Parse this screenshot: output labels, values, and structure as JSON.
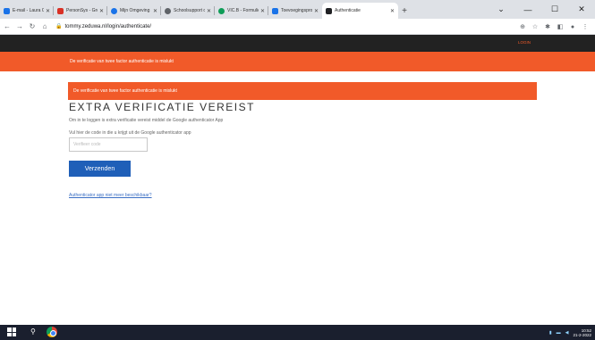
{
  "browser": {
    "tabs": [
      {
        "label": "E-mail - Laura Calleri",
        "favicon_color": "#1a73e8"
      },
      {
        "label": "PersonSys - Groep",
        "favicon_color": "#d93025"
      },
      {
        "label": "Mijn Omgeving Zedu",
        "favicon_color": "#1a73e8"
      },
      {
        "label": "Schoolsupport dashb",
        "favicon_color": "#5f6368"
      },
      {
        "label": "VIC.B - Formulieren T",
        "favicon_color": "#0f9d58"
      },
      {
        "label": "Toevoegingsprogramm",
        "favicon_color": "#1a73e8"
      },
      {
        "label": "Authenticatie",
        "favicon_color": "#202124",
        "active": true
      }
    ],
    "url": "tommy.zeduwa.nl/login/authenticate/"
  },
  "site": {
    "logout_label": "LOGIN",
    "banner_message": "De verificatie van twee factor authenticatie is mislukt",
    "alert_message": "De verificatie van twee factor authenticatie is mislukt",
    "title": "EXTRA VERIFICATIE VEREIST",
    "intro": "Om in te loggen is extra verificatie vereist middel de Google authenticator App",
    "code_label": "Vul hier de code in die u krijgt uit de Google authenticator app",
    "code_placeholder": "Verifieer code",
    "submit_label": "Verzenden",
    "help_link": "Authenticator app niet meer beschikbaar?"
  },
  "taskbar": {
    "time": "10:52",
    "date": "21-2-2022"
  },
  "colors": {
    "accent": "#f15a29",
    "header": "#222222",
    "button": "#1f5fb8"
  }
}
